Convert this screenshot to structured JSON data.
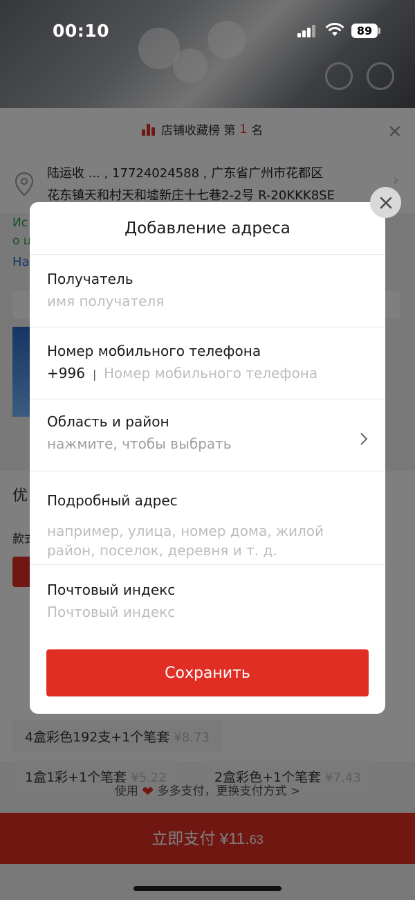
{
  "status_bar": {
    "time": "00:10",
    "battery": "89"
  },
  "background": {
    "store_rank": {
      "prefix": "店铺收藏榜 第",
      "rank": "1",
      "suffix": "名"
    },
    "address": {
      "line1": "陆运收 ... , 17724024588 , 广东省广州市花都区",
      "line2": "花东镇天和村天和墟新庄十七巷2-2号 R-20KKK8SE"
    },
    "green_line1": "Ис",
    "green_line2": "о ц",
    "blue_text": "На",
    "section_prefix": "优",
    "section_sub": "款式",
    "pills": [
      {
        "text": "4盒彩色192支+1个笔套",
        "price": "¥8.73"
      },
      {
        "text": "1盒1彩+1个笔套",
        "price": "¥5.22"
      },
      {
        "text": "2盒彩色+1个笔套",
        "price": "¥7.43"
      }
    ],
    "pay_line": {
      "before": "使用",
      "after": "多多支付，更换支付方式 >"
    },
    "pay_button": {
      "label": "立即支付 ¥11.",
      "cents": "63"
    }
  },
  "modal": {
    "title": "Добавление адреса",
    "recipient": {
      "label": "Получатель",
      "placeholder": "имя получателя"
    },
    "phone": {
      "label": "Номер мобильного телефона",
      "prefix": "+996",
      "separator": "|",
      "placeholder": "Номер мобильного телефона"
    },
    "region": {
      "label": "Область и район",
      "placeholder": "нажмите, чтобы выбрать"
    },
    "detailed": {
      "label": "Подробный адрес",
      "placeholder": "например, улица, номер дома, жилой район, поселок, деревня и т. д."
    },
    "postal": {
      "label": "Почтовый индекс",
      "placeholder": "Почтовый индекс"
    },
    "save_label": "Сохранить"
  },
  "colors": {
    "accent": "#e02e24",
    "placeholder": "#bdbdbd"
  }
}
